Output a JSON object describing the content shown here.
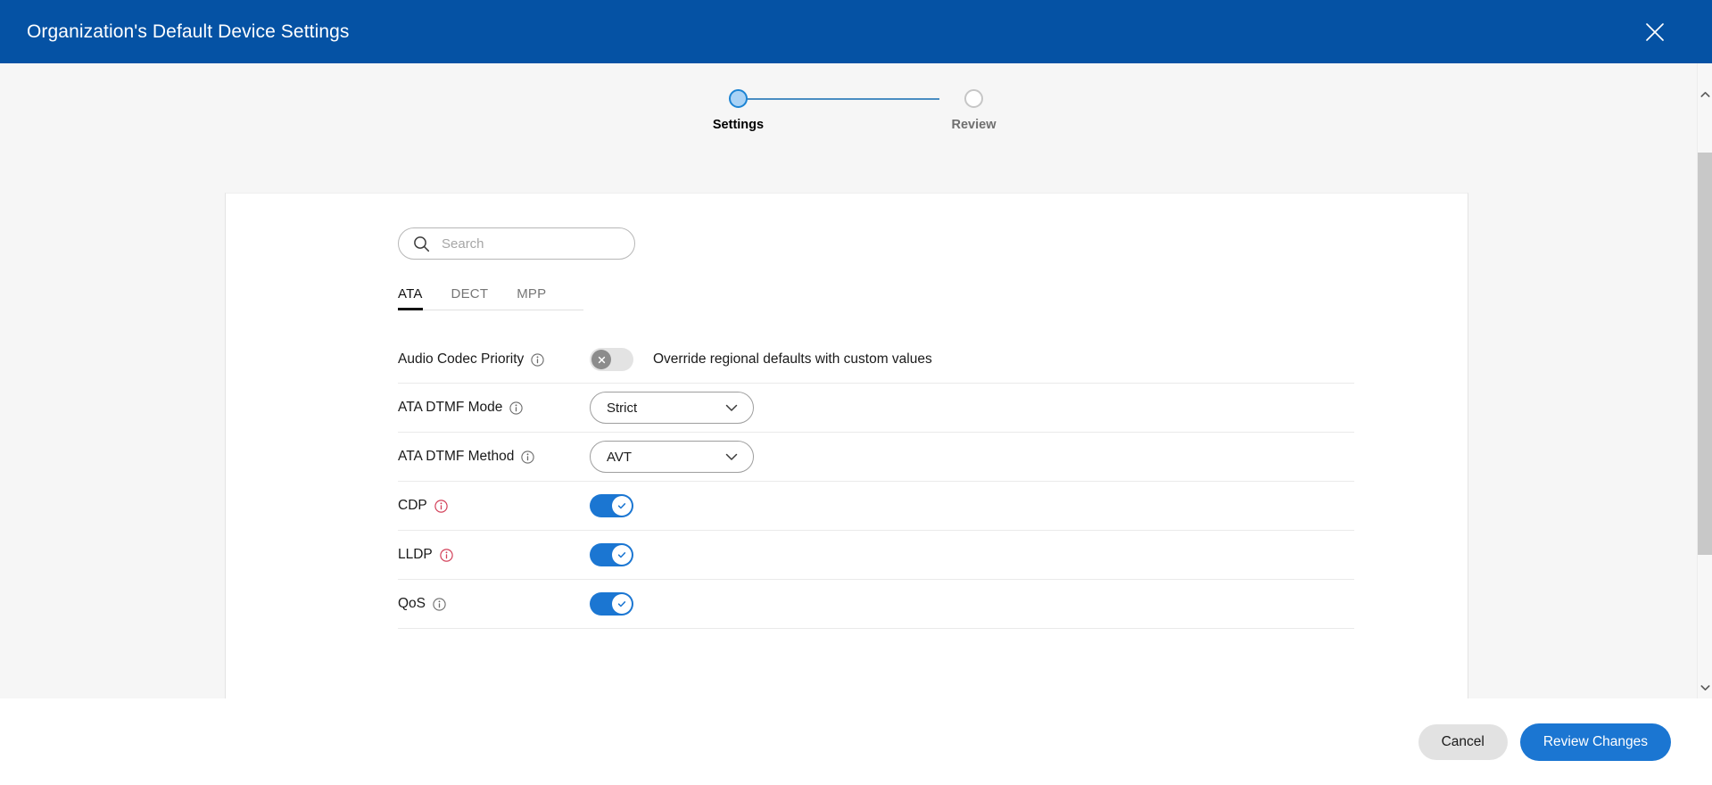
{
  "header": {
    "title": "Organization's Default Device Settings",
    "close_icon": "close-icon",
    "background_color": "#0552a4"
  },
  "stepper": {
    "steps": [
      {
        "label": "Settings",
        "state": "active"
      },
      {
        "label": "Review",
        "state": "inactive"
      }
    ],
    "active_color": "#a9d2f5",
    "line_color": "#4a8dc2"
  },
  "search": {
    "value": "",
    "placeholder": "Search",
    "icon": "search-icon"
  },
  "tabs": [
    {
      "label": "ATA",
      "active": true
    },
    {
      "label": "DECT",
      "active": false
    },
    {
      "label": "MPP",
      "active": false
    }
  ],
  "settings": {
    "rows": [
      {
        "label": "Audio Codec Priority",
        "info_icon": "info-icon",
        "info_state": "default",
        "control": "toggle",
        "toggle_state": "off",
        "description": "Override regional defaults with custom values"
      },
      {
        "label": "ATA DTMF Mode",
        "info_icon": "info-icon",
        "info_state": "default",
        "control": "select",
        "value": "Strict",
        "description": ""
      },
      {
        "label": "ATA DTMF Method",
        "info_icon": "info-icon",
        "info_state": "default",
        "control": "select",
        "value": "AVT",
        "description": ""
      },
      {
        "label": "CDP",
        "info_icon": "info-icon",
        "info_state": "error",
        "control": "toggle",
        "toggle_state": "on",
        "description": ""
      },
      {
        "label": "LLDP",
        "info_icon": "info-icon",
        "info_state": "error",
        "control": "toggle",
        "toggle_state": "on",
        "description": ""
      },
      {
        "label": "QoS",
        "info_icon": "info-icon",
        "info_state": "default",
        "control": "toggle",
        "toggle_state": "on",
        "description": ""
      }
    ]
  },
  "scrollbar": {
    "up_icon": "chevron-up-icon",
    "down_icon": "chevron-down-icon"
  },
  "footer": {
    "cancel_label": "Cancel",
    "primary_label": "Review Changes",
    "primary_color": "#1b76d2"
  },
  "colors": {
    "brand_blue": "#0552a4",
    "accent_blue": "#1b76d2",
    "error_red": "#d3415a",
    "toggle_off": "#e3e3e3"
  }
}
